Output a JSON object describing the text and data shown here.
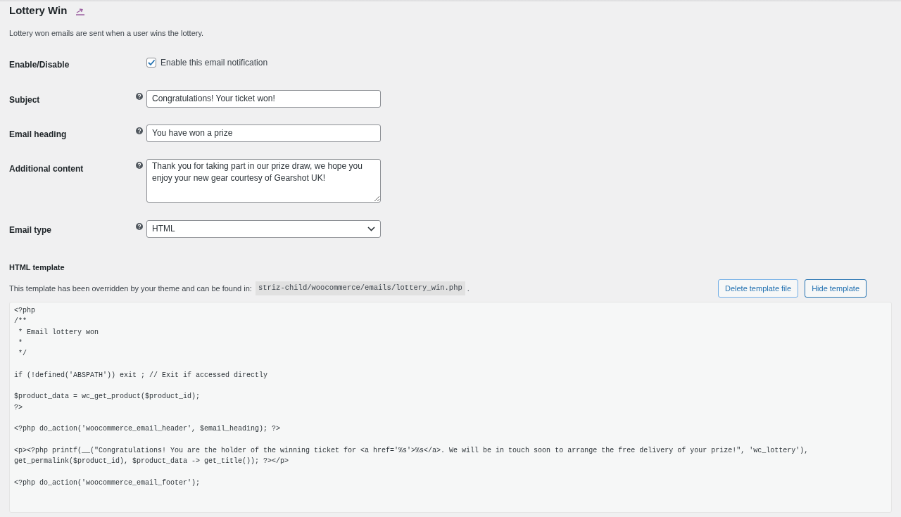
{
  "title": "Lottery Win",
  "description": "Lottery won emails are sent when a user wins the lottery.",
  "fields": [
    {
      "kind": "checkbox",
      "label": "Enable/Disable",
      "text": "Enable this email notification",
      "checked": true
    },
    {
      "kind": "text",
      "label": "Subject",
      "value": "Congratulations! Your ticket won!"
    },
    {
      "kind": "text",
      "label": "Email heading",
      "value": "You have won a prize"
    },
    {
      "kind": "textarea",
      "label": "Additional content",
      "value": "Thank you for taking part in our prize draw, we hope you enjoy your new gear courtesy of Gearshot UK!"
    },
    {
      "kind": "select",
      "label": "Email type",
      "value": "HTML"
    }
  ],
  "template": {
    "heading": "HTML template",
    "note": "This template has been overridden by your theme and can be found in:",
    "path": "striz-child/woocommerce/emails/lottery_win.php",
    "period": ".",
    "buttons": [
      "Delete template file",
      "Hide template"
    ],
    "code": "<?php\n/**\n * Email lottery won\n *\n */\n\nif (!defined('ABSPATH')) exit ; // Exit if accessed directly\n\n$product_data = wc_get_product($product_id);\n?>\n\n<?php do_action('woocommerce_email_header', $email_heading); ?>\n\n<p><?php printf(__(\"Congratulations! You are the holder of the winning ticket for <a href='%s'>%s</a>. We will be in touch soon to arrange the free delivery of your prize!\", 'wc_lottery'),\nget_permalink($product_id), $product_data -> get_title()); ?></p>\n\n<?php do_action('woocommerce_email_footer');"
  }
}
